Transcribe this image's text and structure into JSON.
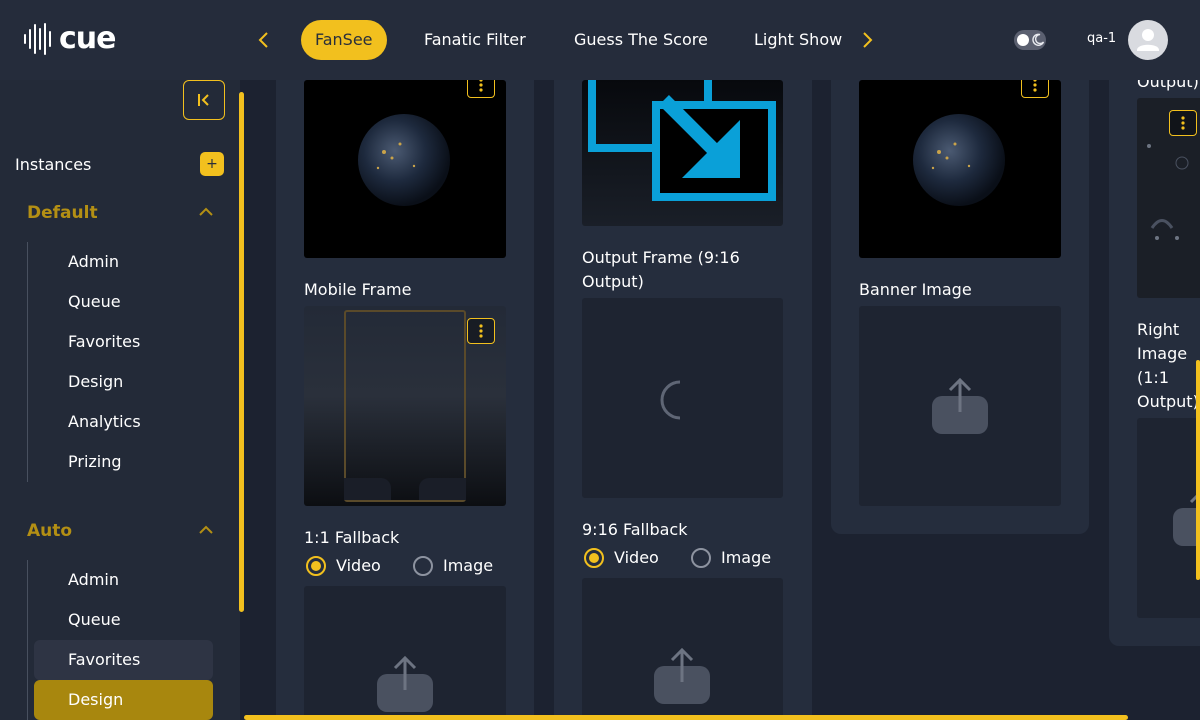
{
  "app": {
    "logo_text": "cue"
  },
  "tabs": [
    {
      "label": "FanSee",
      "active": true
    },
    {
      "label": "Fanatic Filter"
    },
    {
      "label": "Guess The Score"
    },
    {
      "label": "Light Show"
    }
  ],
  "user": {
    "name": "qa-1"
  },
  "colors": {
    "accent": "#f2c01e",
    "background": "#1c2230",
    "panel": "#252d3d"
  },
  "sidebar": {
    "section_title": "Instances",
    "groups": [
      {
        "label": "Default",
        "items": [
          "Admin",
          "Queue",
          "Favorites",
          "Design",
          "Analytics",
          "Prizing"
        ]
      },
      {
        "label": "Auto",
        "items": [
          "Admin",
          "Queue",
          "Favorites",
          "Design"
        ],
        "active_item": "Design",
        "hover_item": "Favorites"
      }
    ]
  },
  "main": {
    "col1": {
      "mobile_frame_label": "Mobile Frame",
      "fallback_label": "1:1 Fallback",
      "radio_video": "Video",
      "radio_image": "Image",
      "selected": "Video"
    },
    "col2": {
      "output_frame_label": "Output Frame (9:16 Output)",
      "fallback_label": "9:16 Fallback",
      "radio_video": "Video",
      "radio_image": "Image",
      "selected": "Video"
    },
    "col3": {
      "banner_label": "Banner Image"
    },
    "col4": {
      "top_partial_label": "Output)",
      "right_image_label": "Right Image (1:1 Output)"
    }
  }
}
